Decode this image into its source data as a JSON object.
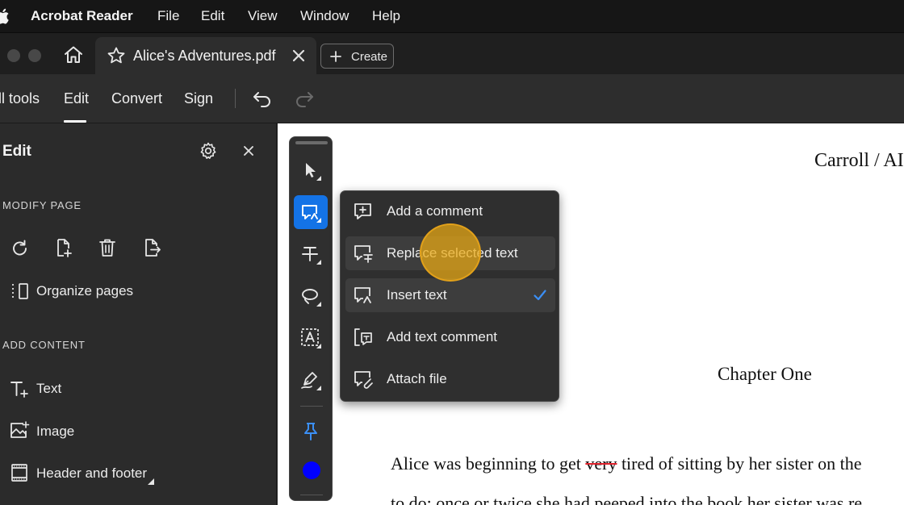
{
  "menubar": {
    "app_name": "Acrobat Reader",
    "items": [
      "File",
      "Edit",
      "View",
      "Window",
      "Help"
    ]
  },
  "tabbar": {
    "tab_title": "Alice's Adventures.pdf",
    "create_label": "Create"
  },
  "toolbar": {
    "items": [
      "ll tools",
      "Edit",
      "Convert",
      "Sign"
    ],
    "active": "Edit"
  },
  "panel": {
    "title": "Edit",
    "sections": {
      "modify_page": "MODIFY PAGE",
      "add_content": "ADD CONTENT"
    },
    "organize_label": "Organize pages",
    "content_items": [
      "Text",
      "Image",
      "Header and footer"
    ]
  },
  "menu": {
    "items": [
      {
        "label": "Add a comment",
        "icon": "comment-add-icon",
        "checked": false
      },
      {
        "label": "Replace selected text",
        "icon": "replace-text-icon",
        "checked": false
      },
      {
        "label": "Insert text",
        "icon": "insert-text-icon",
        "checked": true
      },
      {
        "label": "Add text comment",
        "icon": "text-comment-icon",
        "checked": false
      },
      {
        "label": "Attach file",
        "icon": "attach-file-icon",
        "checked": false
      }
    ]
  },
  "document": {
    "header": "Carroll / AI",
    "chapter": "Chapter One",
    "line1_before": "Alice was beginning to get ",
    "line1_strike": "very",
    "line1_after": " tired of sitting by her sister on the",
    "line2": "to do: once or twice she had peeped into the book her sister was re"
  },
  "colors": {
    "accent": "#1473e6",
    "strike": "#e0202a",
    "color_swatch": "#0000ff",
    "pointer_highlight": "#e2a11a"
  }
}
